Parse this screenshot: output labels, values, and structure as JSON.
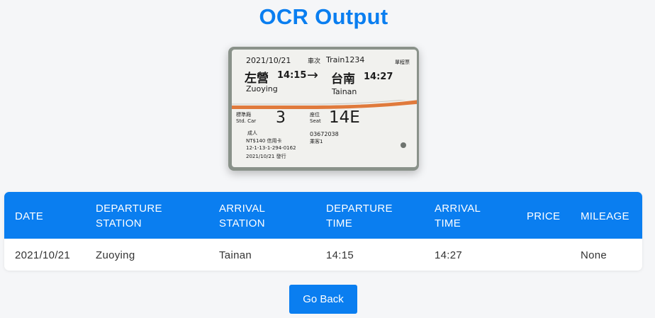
{
  "page": {
    "title": "OCR Output"
  },
  "ticket_image": {
    "date": "2021/10/21",
    "train_label": "車次",
    "train_number": "Train1234",
    "ticket_kind": "單程票",
    "from_zh": "左營",
    "departure": "14:15",
    "arrow": "→",
    "to_zh": "台南",
    "arrival": "14:27",
    "from_en": "Zuoying",
    "to_en": "Tainan",
    "car_zh": "標準廂",
    "car_en": "Std. Car",
    "car": "3",
    "seat_zh": "座位",
    "seat_en": "Seat",
    "seat": "14E",
    "adult": "成人",
    "price_line": "NT$140 信用卡",
    "code_line": "12-1-13-1-294-0162",
    "issue_line": "2021/10/21 發行",
    "ticket_number": "03672038",
    "passenger": "乘客1",
    "accent_color": "#e07a3c"
  },
  "table": {
    "headers": [
      {
        "line1": "DATE",
        "line2": ""
      },
      {
        "line1": "DEPARTURE",
        "line2": "STATION"
      },
      {
        "line1": "ARRIVAL",
        "line2": "STATION"
      },
      {
        "line1": "DEPARTURE",
        "line2": "TIME"
      },
      {
        "line1": "ARRIVAL",
        "line2": "TIME"
      },
      {
        "line1": "PRICE",
        "line2": ""
      },
      {
        "line1": "MILEAGE",
        "line2": ""
      }
    ],
    "rows": [
      {
        "date": "2021/10/21",
        "departure_station": "Zuoying",
        "arrival_station": "Tainan",
        "departure_time": "14:15",
        "arrival_time": "14:27",
        "price": "",
        "mileage": "None"
      }
    ]
  },
  "actions": {
    "back_label": "Go Back"
  },
  "colors": {
    "primary": "#0a7ef0",
    "background": "#f5f6f8"
  }
}
